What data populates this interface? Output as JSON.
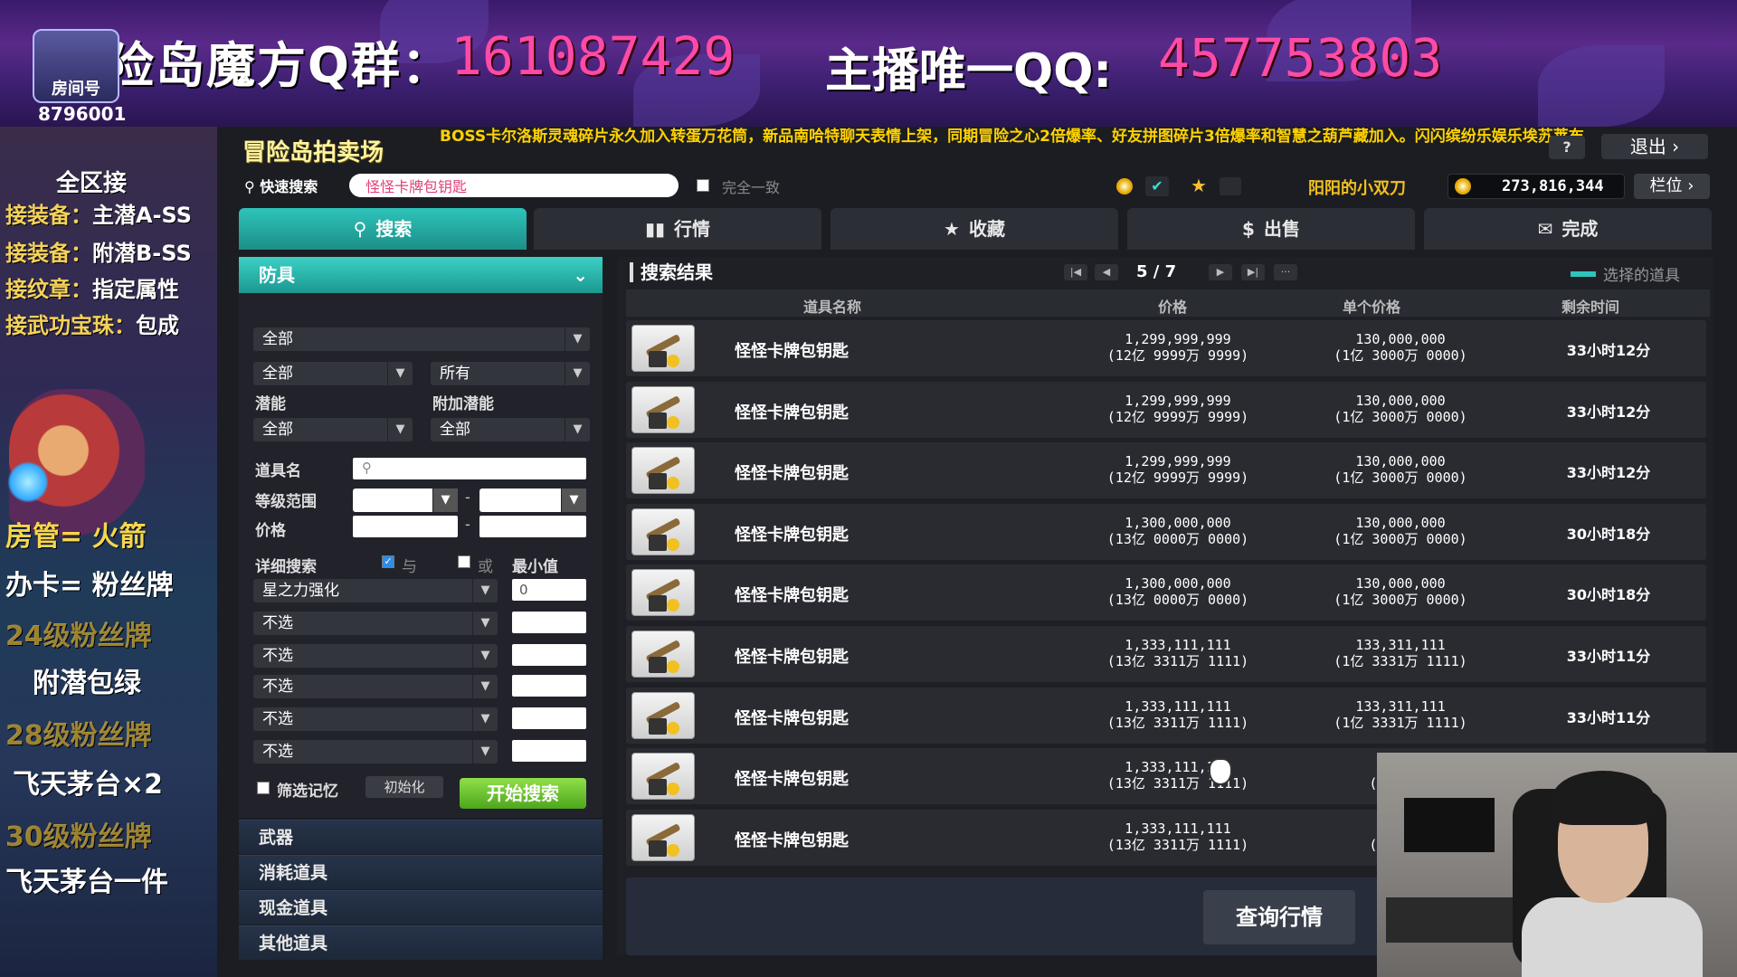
{
  "banner": {
    "left_text": "冒险岛魔方Q群：",
    "left_qq": "161087429",
    "right_text": "主播唯一QQ:",
    "right_qq": "457753803",
    "room_label": "房间号",
    "room_number": "8796001"
  },
  "overlay": {
    "title": "全区接",
    "lines": [
      {
        "label": "接装备：",
        "value": "主潜A-SS"
      },
      {
        "label": "接装备：",
        "value": "附潜B-SS"
      },
      {
        "label": "接纹章：",
        "value": "指定属性"
      },
      {
        "label": "接武功宝珠：",
        "value": "包成"
      }
    ],
    "promos": [
      "房管=  火箭",
      "办卡=  粉丝牌",
      "24级粉丝牌",
      "附潜包绿",
      "28级粉丝牌",
      "飞天茅台×2",
      "30级粉丝牌",
      "飞天茅台一件"
    ]
  },
  "game": {
    "title": "冒险岛拍卖场",
    "ticker": "BOSS卡尔洛斯灵魂碎片永久加入转蛋万花筒，新品南哈特聊天表情上架，同期冒险之心2倍爆率、好友拼图碎片3倍爆率和智慧之葫芦藏加入。闪闪缤纷乐娱乐埃苏莱布",
    "help": "?",
    "exit": "退出 ›",
    "quick_search_label": "快速搜索",
    "quick_search_value": "怪怪卡牌包钥匙",
    "exact_match": "完全一致",
    "player_name": "阳阳的小双刀",
    "meso": "273,816,344",
    "slots": "栏位 ›",
    "tabs": [
      "搜索",
      "行情",
      "收藏",
      "出售",
      "完成"
    ],
    "tab_icons": [
      "search-icon",
      "chart-icon",
      "star-icon",
      "coin-icon",
      "mail-icon"
    ]
  },
  "filters": {
    "category": "防具",
    "sel_all_1": "全部",
    "sel_all_2": "全部",
    "sel_owner": "所有",
    "potential_label": "潜能",
    "extra_potential_label": "附加潜能",
    "potential_value": "全部",
    "extra_potential_value": "全部",
    "item_name_label": "道具名",
    "level_range_label": "等级范围",
    "price_label": "价格",
    "detail_label": "详细搜索",
    "and_label": "与",
    "or_label": "或",
    "min_label": "最小值",
    "stat_rows": [
      {
        "name": "星之力强化",
        "value": "0"
      },
      {
        "name": "不选",
        "value": ""
      },
      {
        "name": "不选",
        "value": ""
      },
      {
        "name": "不选",
        "value": ""
      },
      {
        "name": "不选",
        "value": ""
      },
      {
        "name": "不选",
        "value": ""
      }
    ],
    "remember_label": "筛选记忆",
    "reset_label": "初始化",
    "start_label": "开始搜索",
    "categories": [
      "武器",
      "消耗道具",
      "现金道具",
      "其他道具"
    ]
  },
  "results": {
    "title": "搜索结果",
    "page": "5 / 7",
    "selected_legend": "选择的道具",
    "headers": [
      "道具名称",
      "价格",
      "单个价格",
      "剩余时间"
    ],
    "rows": [
      {
        "name": "怪怪卡牌包钥匙",
        "price": "1,299,999,999",
        "price_cn": "(12亿 9999万 9999)",
        "unit": "130,000,000",
        "unit_cn": "(1亿 3000万 0000)",
        "time": "33小时12分"
      },
      {
        "name": "怪怪卡牌包钥匙",
        "price": "1,299,999,999",
        "price_cn": "(12亿 9999万 9999)",
        "unit": "130,000,000",
        "unit_cn": "(1亿 3000万 0000)",
        "time": "33小时12分"
      },
      {
        "name": "怪怪卡牌包钥匙",
        "price": "1,299,999,999",
        "price_cn": "(12亿 9999万 9999)",
        "unit": "130,000,000",
        "unit_cn": "(1亿 3000万 0000)",
        "time": "33小时12分"
      },
      {
        "name": "怪怪卡牌包钥匙",
        "price": "1,300,000,000",
        "price_cn": "(13亿 0000万 0000)",
        "unit": "130,000,000",
        "unit_cn": "(1亿 3000万 0000)",
        "time": "30小时18分"
      },
      {
        "name": "怪怪卡牌包钥匙",
        "price": "1,300,000,000",
        "price_cn": "(13亿 0000万 0000)",
        "unit": "130,000,000",
        "unit_cn": "(1亿 3000万 0000)",
        "time": "30小时18分"
      },
      {
        "name": "怪怪卡牌包钥匙",
        "price": "1,333,111,111",
        "price_cn": "(13亿 3311万 1111)",
        "unit": "133,311,111",
        "unit_cn": "(1亿 3331万 1111)",
        "time": "33小时11分"
      },
      {
        "name": "怪怪卡牌包钥匙",
        "price": "1,333,111,111",
        "price_cn": "(13亿 3311万 1111)",
        "unit": "133,311,111",
        "unit_cn": "(1亿 3331万 1111)",
        "time": "33小时11分"
      },
      {
        "name": "怪怪卡牌包钥匙",
        "price": "1,333,111,111",
        "price_cn": "(13亿 3311万 1111)",
        "unit": "133,3",
        "unit_cn": "(1亿 333",
        "time": ""
      },
      {
        "name": "怪怪卡牌包钥匙",
        "price": "1,333,111,111",
        "price_cn": "(13亿 3311万 1111)",
        "unit": "133,3",
        "unit_cn": "(1亿 333",
        "time": ""
      }
    ],
    "query_market": "查询行情"
  },
  "colors": {
    "accent_teal": "#2fc4ba",
    "ticker_yellow": "#ffd200",
    "qq_pink": "#ff4aa8",
    "start_green": "#4ea61c"
  }
}
